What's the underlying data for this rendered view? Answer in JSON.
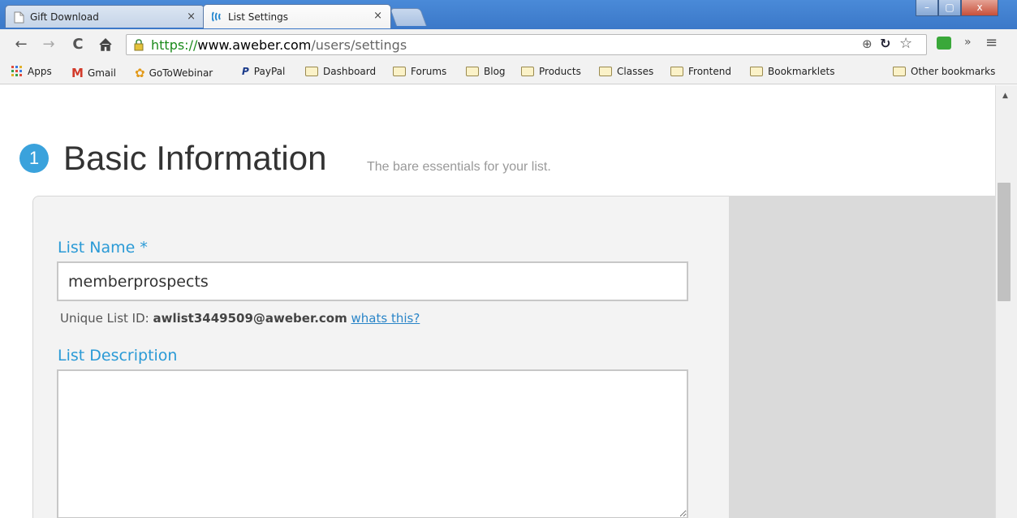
{
  "browser": {
    "tabs": [
      {
        "label": "Gift Download",
        "active": false
      },
      {
        "label": "List Settings",
        "active": true
      }
    ],
    "tab_close_glyph": "×",
    "window_controls": {
      "minimize": "–",
      "maximize": "▢",
      "close": "x"
    },
    "address": {
      "scheme": "https://",
      "domain": "www.aweber.com",
      "path": "/users/settings"
    },
    "bookmarks": [
      "Apps",
      "Gmail",
      "GoToWebinar",
      "PayPal",
      "Dashboard",
      "Forums",
      "Blog",
      "Products",
      "Classes",
      "Frontend",
      "Bookmarklets"
    ],
    "other_bookmarks": "Other bookmarks",
    "overflow_glyph": "»"
  },
  "section": {
    "step_number": "1",
    "title": "Basic Information",
    "subtitle": "The bare essentials for your list."
  },
  "form": {
    "list_name_label": "List Name *",
    "list_name_value": "memberprospects",
    "unique_id_prefix": "Unique List ID: ",
    "unique_id_value": "awlist3449509@aweber.com",
    "whats_this": "whats this?",
    "list_description_label": "List Description",
    "list_description_value": ""
  },
  "colors": {
    "accent_blue": "#2a9ad6",
    "link_blue": "#2a85c8",
    "titlebar_blue": "#4a8ad8",
    "secure_green": "#1a8a1a"
  }
}
